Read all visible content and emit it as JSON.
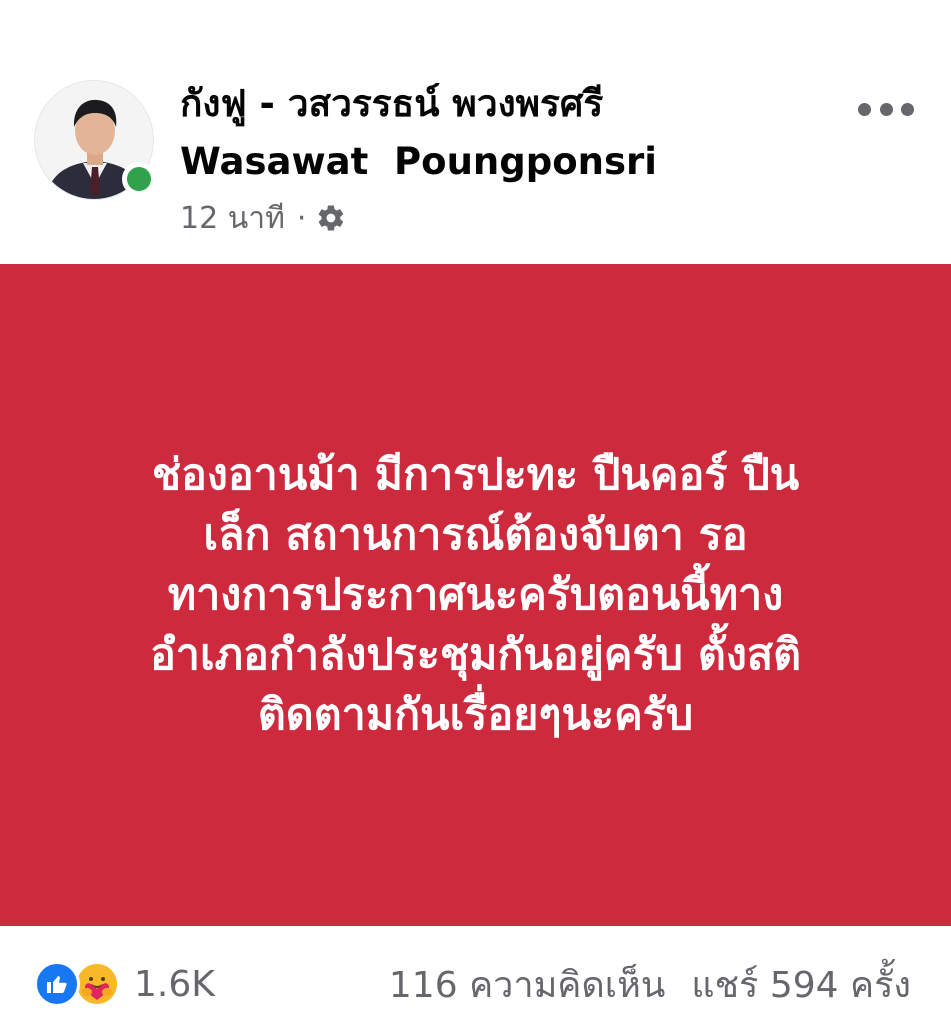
{
  "post": {
    "author_name_th": "กังฟู - วสวรรธน์ พวงพรศรี",
    "author_name_en": "Wasawat  Poungponsri",
    "timestamp": "12 นาที",
    "separator": "·",
    "privacy_icon": "gear-icon",
    "more_icon": "more-options-icon",
    "body_text": "ช่องอานม้า มีการปะทะ ปืนคอร์ ปืน\nเล็ก สถานการณ์ต้องจับตา รอ\nทางการประกาศนะครับตอนนี้ทาง\nอำเภอกำลังประชุมกันอยู่ครับ ตั้งสติ\nติดตามกันเรื่อยๆนะครับ",
    "background_color": "#cd2a3e"
  },
  "engagement": {
    "reaction_icons": [
      "like-reaction-icon",
      "care-reaction-icon"
    ],
    "reaction_count": "1.6K",
    "comments": "116 ความคิดเห็น",
    "shares": "แชร์ 594 ครั้ง"
  },
  "colors": {
    "like_blue": "#1877f2",
    "online_green": "#31a24c",
    "secondary_text": "#65676b"
  }
}
